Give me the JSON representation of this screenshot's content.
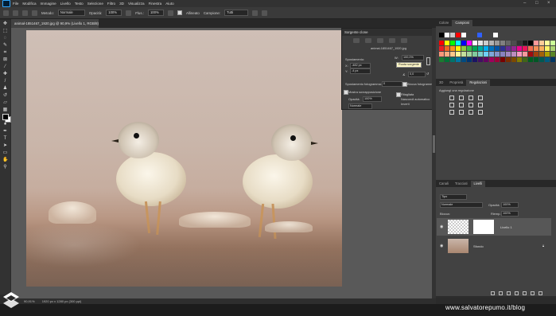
{
  "menubar": {
    "items": [
      "File",
      "Modifica",
      "Immagine",
      "Livello",
      "Testo",
      "Selezione",
      "Filtro",
      "3D",
      "Visualizza",
      "Finestra",
      "Aiuto"
    ]
  },
  "options": {
    "mode_label": "Metodo:",
    "mode_value": "Normale",
    "opacity_label": "Opacità:",
    "opacity_value": "100%",
    "flow_label": "Flus.:",
    "flow_value": "100%",
    "aligned_label": "Allineato",
    "sample_label": "Campione:",
    "sample_value": "Tutti"
  },
  "document": {
    "tab_title": "animal-1851467_1920.jpg @ 90,9% (Livello 1, RGB/8) *",
    "status_zoom": "90,91%",
    "status_info": "1920 px x 1280 px (300 ppi)"
  },
  "clone_source": {
    "title": "Sorgente clone",
    "filename": "animal-1851467_1920.jpg",
    "offset_label": "Spostamento:",
    "x_label": "X:",
    "x_value": "-482 px",
    "y_label": "Y:",
    "y_value": "-4 px",
    "w_value": "W:",
    "scale_value": "100,0%",
    "angle_value": "0,0",
    "tooltip": "Ruota sorgente",
    "frame_offset_label": "Spostamento fotogramma:",
    "frame_offset_value": "0",
    "lock_frame_label": "Blocca fotogramma",
    "show_overlay_label": "Mostra sovrapposizione",
    "clipped_label": "Ritagliata",
    "autohide_label": "Nascondi automatico",
    "invert_label": "Inverti",
    "opacity_label": "Opacità:",
    "opacity_value": "100%",
    "blend_value": "Normale"
  },
  "right_dock": {
    "tabs_top": [
      "Colore",
      "Campioni"
    ],
    "tabs_mid": [
      "3D",
      "Proprietà",
      "Regolazioni"
    ],
    "adjustments_title": "Aggiungi una regolazione",
    "tabs_layers": [
      "Canali",
      "Tracciati",
      "Livelli"
    ],
    "kind_value": "Tipo",
    "blend_value": "Normale",
    "opacity_label": "Opacità:",
    "opacity_value": "100%",
    "lock_label": "Blocca:",
    "fill_label": "Riemp.:",
    "fill_value": "100%",
    "layers": [
      {
        "name": "Livello 1"
      },
      {
        "name": "Sfondo"
      }
    ]
  },
  "watermark": "www.salvatorepumo.it/blog",
  "colors": {
    "app_bg": "#2b2b2b",
    "panel": "#424242",
    "accent": "#31a8ff"
  },
  "swatches": {
    "recent": [
      "#000000",
      "#ffffff",
      "#c8c8c8",
      "#ff0000",
      "#ffffff",
      "#3060ff",
      "#ffffff"
    ],
    "grid": [
      "#ff0000",
      "#ffff00",
      "#00ff00",
      "#00ffff",
      "#0000ff",
      "#ff00ff",
      "#ffffff",
      "#e6e6e6",
      "#cccccc",
      "#b3b3b3",
      "#999999",
      "#808080",
      "#666666",
      "#4d4d4d",
      "#333333",
      "#1a1a1a",
      "#000000",
      "#ff9999",
      "#ffcc99",
      "#ffff99",
      "#ccff99",
      "#ed1c24",
      "#f26522",
      "#f7941d",
      "#fff200",
      "#8dc63f",
      "#39b54a",
      "#00a651",
      "#00a99d",
      "#00aeef",
      "#0072bc",
      "#0054a6",
      "#2e3192",
      "#662d91",
      "#92278f",
      "#ec008c",
      "#ed145b",
      "#f26c4f",
      "#f68e56",
      "#fbaf5d",
      "#fff568",
      "#acd373",
      "#f7977a",
      "#f9ad81",
      "#fdc68a",
      "#fff79a",
      "#c4df9b",
      "#a3d39c",
      "#82ca9d",
      "#7bcdc8",
      "#6ecff6",
      "#7ea7d8",
      "#8493ca",
      "#8882be",
      "#a187be",
      "#bc8dbf",
      "#f49ac2",
      "#f6989d",
      "#9e0b0f",
      "#a0410d",
      "#a3620a",
      "#aba000",
      "#598527",
      "#1a7b30",
      "#007236",
      "#00746b",
      "#0076a3",
      "#004b80",
      "#003471",
      "#1b1464",
      "#440e62",
      "#630460",
      "#9e005d",
      "#9e0039",
      "#790000",
      "#7b2e00",
      "#7d4900",
      "#827b00",
      "#406618",
      "#005e20",
      "#005826",
      "#005952",
      "#005b7f",
      "#003663"
    ]
  }
}
